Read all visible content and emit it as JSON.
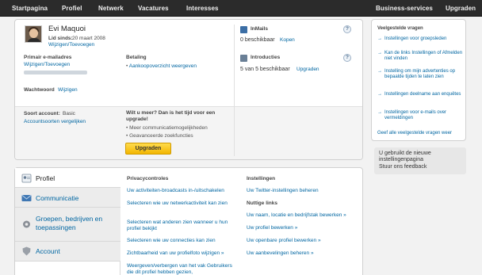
{
  "nav": {
    "left": [
      "Startpagina",
      "Profiel",
      "Netwerk",
      "Vacatures",
      "Interesses"
    ],
    "business": "Business-services",
    "upgrade": "Upgraden"
  },
  "account": {
    "name": "Evi Maquoi",
    "member_since_label": "Lid sinds:",
    "member_since": "20 maart 2008",
    "email_title": "Primair e-mailadres",
    "email_action": "Wijzigen/Toevoegen",
    "password_title": "Wachtwoord",
    "password_action": "Wijzigen",
    "billing_title": "Betaling",
    "billing_link": "Aankoopoverzicht weergeven",
    "account_type_label": "Soort account:",
    "account_type": "Basic",
    "compare_link": "Accountsoorten vergelijken",
    "upgrade_pitch": "Wilt u meer? Dan is het tijd voor een upgrade!",
    "benefits": [
      "Meer communicatiemogelijkheden",
      "Geavanceerde zoekfuncties"
    ],
    "upgrade_button": "Upgraden"
  },
  "inmails": {
    "title": "InMails",
    "value": "0 beschikbaar",
    "action": "Kopen"
  },
  "introductions": {
    "title": "Introducties",
    "value": "5 van 5 beschikbaar",
    "action": "Upgraden"
  },
  "faq": {
    "title": "Veelgestelde vragen",
    "items": [
      "Instellingen voor groepsleden",
      "Kan de links Instellingen of Afmelden niet vinden",
      "Instelling om mijn advertenties op bepaalde tijden te laten zien",
      "Instellingen deelname aan enquêtes",
      "Instellingen voor e-mails over vermeldingen"
    ],
    "all_link": "Geef alle veelgestelde vragen weer"
  },
  "feedback": {
    "text": "U gebruikt de nieuwe instellingenpagina",
    "link": "Stuur ons feedback"
  },
  "settings": {
    "tabs": [
      "Profiel",
      "Communicatie",
      "Groepen, bedrijven en toepassingen",
      "Account"
    ],
    "privacy_title": "Privacycontroles",
    "privacy_links": [
      "Uw activiteiten-broadcasts in-/uitschakelen",
      "Selecteren wie uw netwerkactiviteit kan zien",
      "Selecteren wat anderen zien wanneer u hun profiel bekijkt",
      "Selecteren wie uw connecties kan zien",
      "Zichtbaarheid van uw profielfoto wijzigen »",
      "Weergeven/verbergen van het vak Gebruikers die dit profiel hebben gezien,"
    ],
    "settings_title": "Instellingen",
    "settings_links": [
      "Uw Twitter-instellingen beheren"
    ],
    "useful_title": "Nuttige links",
    "useful_links": [
      "Uw naam, locatie en bedrijfstak bewerken »",
      "Uw profiel bewerken »",
      "Uw openbare profiel bewerken »",
      "Uw aanbevelingen beheren »"
    ]
  },
  "icons": {
    "help": "?"
  },
  "colors": {
    "link": "#0066a2",
    "nav_bg": "#2b2b2b",
    "upgrade_button": "#f3b600"
  }
}
